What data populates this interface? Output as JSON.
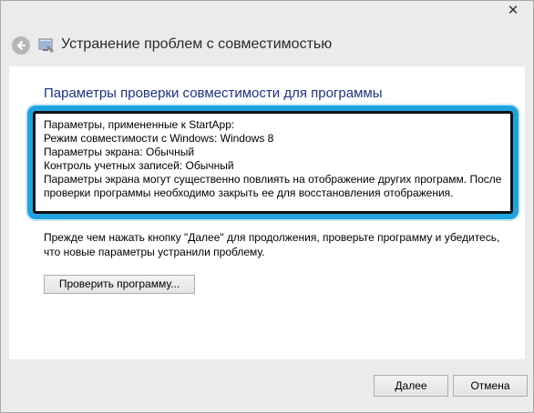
{
  "window": {
    "close_glyph": "✕"
  },
  "navbar": {
    "title": "Устранение проблем с совместимостью"
  },
  "content": {
    "heading": "Параметры проверки совместимости для программы",
    "params": [
      "Параметры, примененные к  StartApp:",
      "Режим совместимости с Windows: Windows 8",
      "Параметры экрана:  Обычный",
      "Контроль учетных записей:  Обычный"
    ],
    "note": "Параметры экрана могут существенно повлиять на отображение других программ. После проверки программы необходимо закрыть ее для восстановления отображения.",
    "instruction": "Прежде чем нажать кнопку \"Далее\" для продолжения, проверьте программу и убедитесь, что новые параметры устранили проблему.",
    "test_button_label": "Проверить программу..."
  },
  "footer": {
    "next_label": "Далее",
    "cancel_label": "Отмена"
  },
  "colors": {
    "highlight": "#1fa3de",
    "heading": "#1e3287"
  }
}
